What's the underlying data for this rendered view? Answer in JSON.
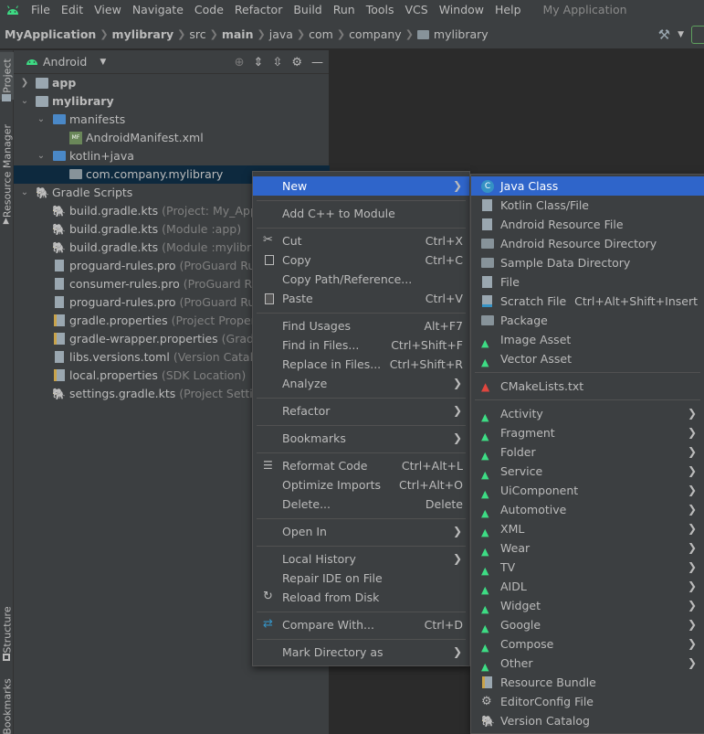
{
  "menubar": {
    "items": [
      "File",
      "Edit",
      "View",
      "Navigate",
      "Code",
      "Refactor",
      "Build",
      "Run",
      "Tools",
      "VCS",
      "Window",
      "Help"
    ],
    "app_title": "My Application"
  },
  "breadcrumb": [
    "MyApplication",
    "mylibrary",
    "src",
    "main",
    "java",
    "com",
    "company",
    "mylibrary"
  ],
  "toolwindows": {
    "project": "Project",
    "resource_manager": "Resource Manager",
    "structure": "Structure",
    "bookmarks": "Bookmarks"
  },
  "panel": {
    "view": "Android"
  },
  "tree": [
    {
      "label": "app",
      "hint": "",
      "bold": true
    },
    {
      "label": "mylibrary",
      "hint": "",
      "bold": true
    },
    {
      "label": "manifests",
      "hint": ""
    },
    {
      "label": "AndroidManifest.xml",
      "hint": ""
    },
    {
      "label": "kotlin+java",
      "hint": ""
    },
    {
      "label": "com.company.mylibrary",
      "hint": ""
    },
    {
      "label": "Gradle Scripts",
      "hint": ""
    },
    {
      "label": "build.gradle.kts",
      "hint": "(Project: My_Applicat"
    },
    {
      "label": "build.gradle.kts",
      "hint": "(Module :app)"
    },
    {
      "label": "build.gradle.kts",
      "hint": "(Module :mylibrary)"
    },
    {
      "label": "proguard-rules.pro",
      "hint": "(ProGuard Rules fo"
    },
    {
      "label": "consumer-rules.pro",
      "hint": "(ProGuard Rules fo"
    },
    {
      "label": "proguard-rules.pro",
      "hint": "(ProGuard Rules fo"
    },
    {
      "label": "gradle.properties",
      "hint": "(Project Properties)"
    },
    {
      "label": "gradle-wrapper.properties",
      "hint": "(Gradle Vers"
    },
    {
      "label": "libs.versions.toml",
      "hint": "(Version Catalog)"
    },
    {
      "label": "local.properties",
      "hint": "(SDK Location)"
    },
    {
      "label": "settings.gradle.kts",
      "hint": "(Project Settings)"
    }
  ],
  "context_menu": {
    "new": "New",
    "add_cpp": "Add C++ to Module",
    "cut": "Cut",
    "cut_key": "Ctrl+X",
    "copy": "Copy",
    "copy_key": "Ctrl+C",
    "copy_path": "Copy Path/Reference...",
    "paste": "Paste",
    "paste_key": "Ctrl+V",
    "find_usages": "Find Usages",
    "find_usages_key": "Alt+F7",
    "find_in_files": "Find in Files...",
    "find_in_files_key": "Ctrl+Shift+F",
    "replace_in_files": "Replace in Files...",
    "replace_in_files_key": "Ctrl+Shift+R",
    "analyze": "Analyze",
    "refactor": "Refactor",
    "bookmarks": "Bookmarks",
    "reformat": "Reformat Code",
    "reformat_key": "Ctrl+Alt+L",
    "optimize": "Optimize Imports",
    "optimize_key": "Ctrl+Alt+O",
    "delete": "Delete...",
    "delete_key": "Delete",
    "open_in": "Open In",
    "local_history": "Local History",
    "repair": "Repair IDE on File",
    "reload": "Reload from Disk",
    "compare": "Compare With...",
    "compare_key": "Ctrl+D",
    "mark_dir": "Mark Directory as"
  },
  "submenu": {
    "java_class": "Java Class",
    "kotlin_class": "Kotlin Class/File",
    "android_resource_file": "Android Resource File",
    "android_resource_dir": "Android Resource Directory",
    "sample_data_dir": "Sample Data Directory",
    "file": "File",
    "scratch_file": "Scratch File",
    "scratch_key": "Ctrl+Alt+Shift+Insert",
    "package": "Package",
    "image_asset": "Image Asset",
    "vector_asset": "Vector Asset",
    "cmake": "CMakeLists.txt",
    "activity": "Activity",
    "fragment": "Fragment",
    "folder": "Folder",
    "service": "Service",
    "uicomponent": "UiComponent",
    "automotive": "Automotive",
    "xml": "XML",
    "wear": "Wear",
    "tv": "TV",
    "aidl": "AIDL",
    "widget": "Widget",
    "google": "Google",
    "compose": "Compose",
    "other": "Other",
    "resource_bundle": "Resource Bundle",
    "editorconfig": "EditorConfig File",
    "version_catalog": "Version Catalog"
  },
  "colors": {
    "menu_highlight": "#2f65ca",
    "android_green": "#3ddc84",
    "panel_bg": "#3c3f41",
    "editor_bg": "#2b2b2b",
    "selection": "#0d293e"
  }
}
